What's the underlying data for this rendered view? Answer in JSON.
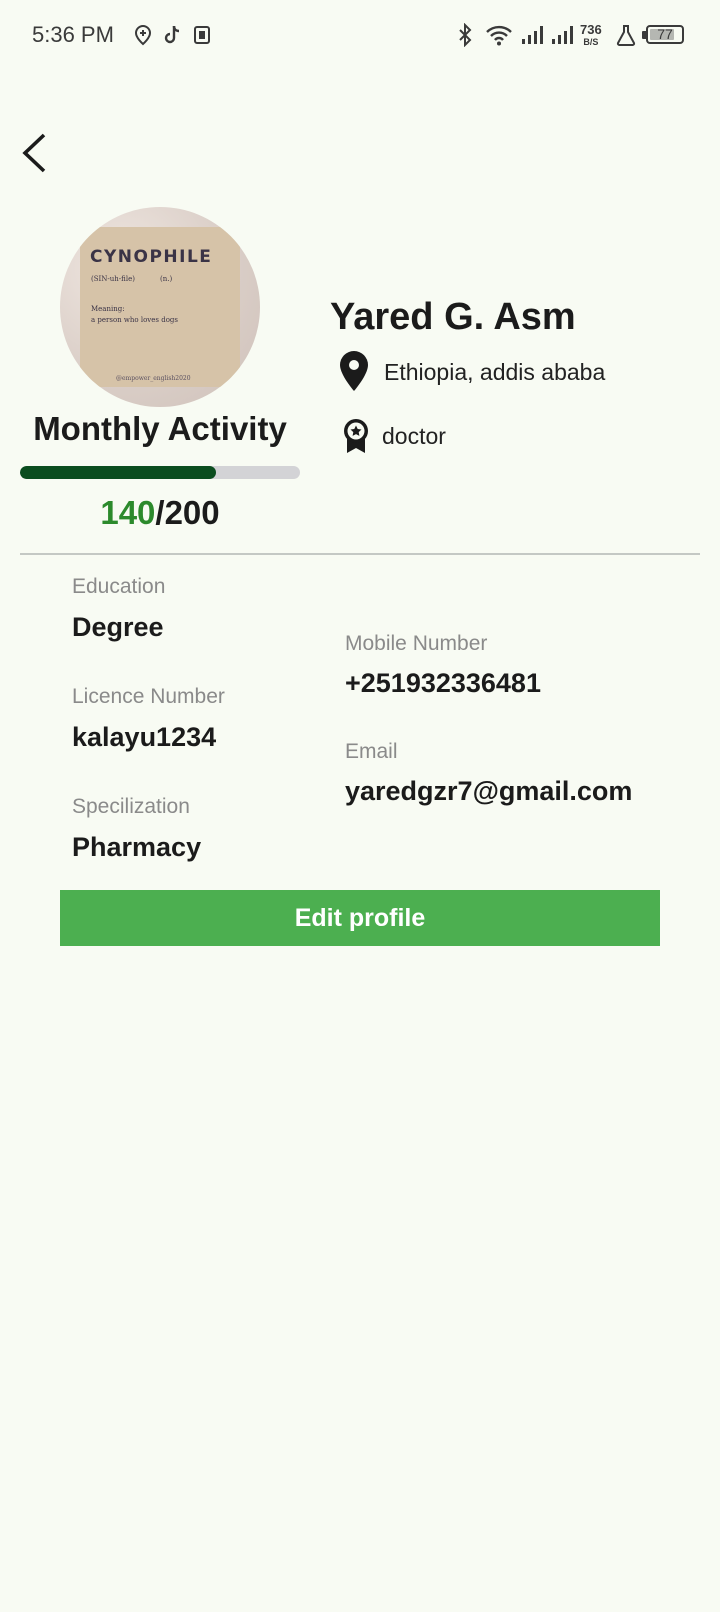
{
  "status_bar": {
    "time": "5:36 PM",
    "net_speed_value": "736",
    "net_speed_unit": "B/S",
    "battery": "77",
    "icons": [
      "location-icon",
      "tiktok-icon",
      "sim-icon",
      "bluetooth-icon",
      "wifi-icon",
      "signal-icon",
      "signal-icon",
      "lab-icon",
      "battery-icon"
    ]
  },
  "navigation": {
    "back_icon": "chevron-left-icon"
  },
  "avatar": {
    "title": "CYNOPHILE",
    "pronunciation": "(SIN-uh-file)",
    "part_of_speech": "(n.)",
    "meaning_label": "Meaning:",
    "definition": "a person who loves dogs",
    "credit": "@empower_english2020"
  },
  "activity": {
    "title": "Monthly Activity",
    "current": "140",
    "total": "/200",
    "progress_fraction": 0.7,
    "fill_color": "#0b4d1f",
    "track_color": "#d3d3d6"
  },
  "profile": {
    "name": "Yared G. Asm",
    "location": "Ethiopia, addis ababa",
    "role": "doctor"
  },
  "details": {
    "education_label": "Education",
    "education_value": "Degree",
    "licence_label": "Licence Number",
    "licence_value": "kalayu1234",
    "specialization_label": "Specilization",
    "specialization_value": "Pharmacy",
    "mobile_label": "Mobile Number",
    "mobile_value": "+251932336481",
    "email_label": "Email",
    "email_value": "yaredgzr7@gmail.com"
  },
  "actions": {
    "edit_label": "Edit profile",
    "accent_color": "#4caf50"
  }
}
